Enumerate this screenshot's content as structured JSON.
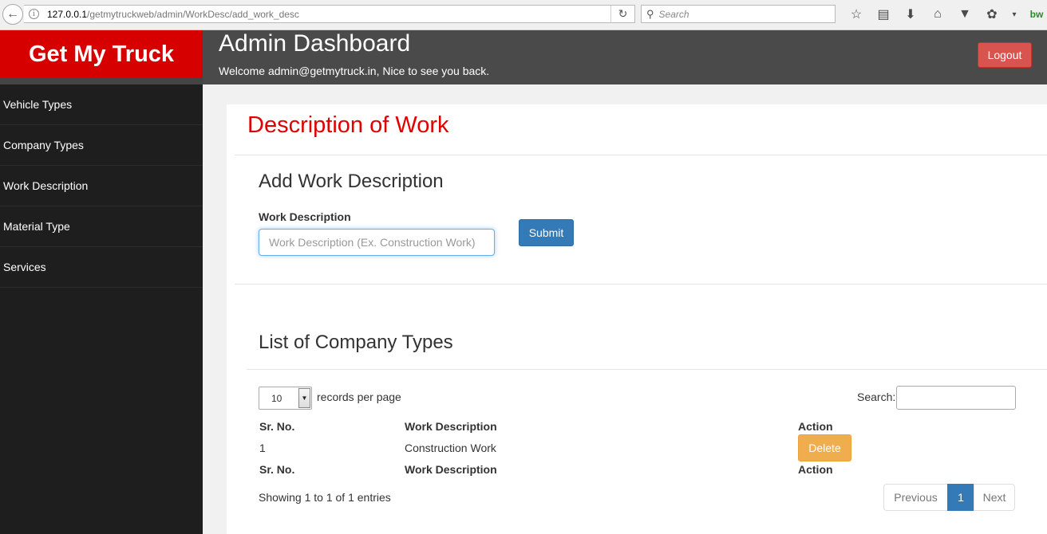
{
  "browser": {
    "url_host": "127.0.0.1",
    "url_path": "/getmytruckweb/admin/WorkDesc/add_work_desc",
    "search_placeholder": "Search",
    "addon_label": "bw"
  },
  "brand": {
    "name": "Get My Truck"
  },
  "header": {
    "title": "Admin Dashboard",
    "welcome": "Welcome admin@getmytruck.in, Nice to see you back.",
    "logout_label": "Logout"
  },
  "sidebar": {
    "items": [
      {
        "label": "Vehicle Types"
      },
      {
        "label": "Company Types"
      },
      {
        "label": "Work Description"
      },
      {
        "label": "Material Type"
      },
      {
        "label": "Services"
      }
    ]
  },
  "main": {
    "page_title": "Description of Work",
    "form": {
      "title": "Add Work Description",
      "field_label": "Work Description",
      "field_value": "",
      "field_placeholder": "Work Description (Ex. Construction Work)",
      "submit_label": "Submit"
    },
    "list": {
      "title": "List of Company Types",
      "page_length": "10",
      "page_length_suffix": "records per page",
      "search_label": "Search:",
      "search_value": "",
      "columns": [
        "Sr. No.",
        "Work Description",
        "Action"
      ],
      "rows": [
        {
          "sr_no": "1",
          "work_description": "Construction Work",
          "action_label": "Delete"
        }
      ],
      "info": "Showing 1 to 1 of 1 entries",
      "pagination": {
        "previous": "Previous",
        "current_page": "1",
        "next": "Next"
      }
    }
  },
  "colors": {
    "brand_red": "#d60000",
    "header_bg": "#4a4a4a",
    "sidebar_bg": "#1e1e1e",
    "title_red": "#e00000",
    "primary": "#337ab7",
    "warning": "#f0ad4e",
    "danger": "#d9534f"
  }
}
